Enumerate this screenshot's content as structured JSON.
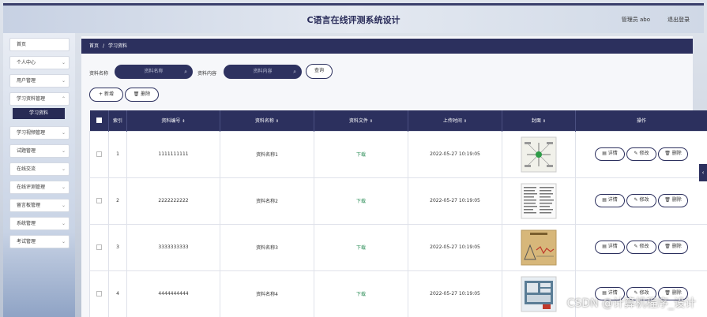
{
  "header": {
    "title": "C语言在线评测系统设计",
    "user": "管理员 abo",
    "logout": "退出登录"
  },
  "sidebar": {
    "items": [
      {
        "label": "首页",
        "chevron": false
      },
      {
        "label": "个人中心",
        "chevron": true
      },
      {
        "label": "用户管理",
        "chevron": true
      },
      {
        "label": "学习资料管理",
        "chevron": true
      },
      {
        "label": "学习视频管理",
        "chevron": true
      },
      {
        "label": "试题管理",
        "chevron": true
      },
      {
        "label": "在线交流",
        "chevron": true
      },
      {
        "label": "在线评测管理",
        "chevron": true
      },
      {
        "label": "留言板管理",
        "chevron": true
      },
      {
        "label": "系统管理",
        "chevron": true
      },
      {
        "label": "考试管理",
        "chevron": true
      }
    ],
    "active_sub": "学习资料"
  },
  "breadcrumb": {
    "home": "首页",
    "current": "学习资料",
    "separator": "/"
  },
  "search": {
    "name_label": "资料名称",
    "name_placeholder": "资料名称",
    "content_label": "资料内容",
    "content_placeholder": "资料内容",
    "query": "查询"
  },
  "toolbar": {
    "add": "+ 新增",
    "delete": "删除"
  },
  "table": {
    "headers": [
      "",
      "索引",
      "资料编号",
      "资料名称",
      "资料文件",
      "上传时间",
      "封面",
      "操作"
    ],
    "sortable": [
      false,
      false,
      true,
      true,
      true,
      true,
      true,
      false
    ],
    "rows": [
      {
        "index": "1",
        "code": "1111111111",
        "name": "资料名称1",
        "file": "下载",
        "time": "2022-05-27 10:19:05"
      },
      {
        "index": "2",
        "code": "2222222222",
        "name": "资料名称2",
        "file": "下载",
        "time": "2022-05-27 10:19:05"
      },
      {
        "index": "3",
        "code": "3333333333",
        "name": "资料名称3",
        "file": "下载",
        "time": "2022-05-27 10:19:05"
      },
      {
        "index": "4",
        "code": "4444444444",
        "name": "资料名称4",
        "file": "下载",
        "time": "2022-05-27 10:19:05"
      }
    ],
    "actions": {
      "detail": "详情",
      "edit": "修改",
      "delete": "删除"
    }
  },
  "watermark": "CSDN @计算机程序_设计",
  "colors": {
    "primary": "#2c305e",
    "download": "#2f8f5a"
  }
}
